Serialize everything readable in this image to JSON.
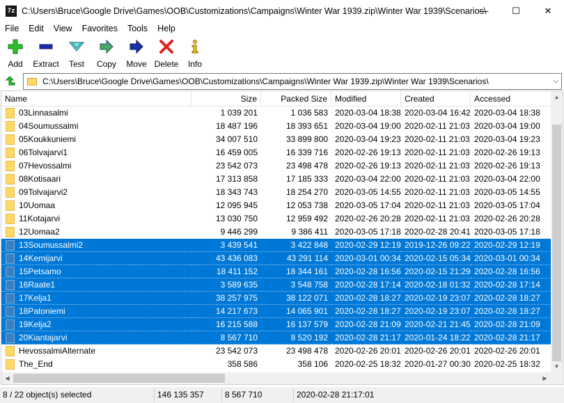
{
  "window": {
    "app_icon_text": "7z",
    "title": "C:\\Users\\Bruce\\Google Drive\\Games\\OOB\\Customizations\\Campaigns\\Winter War 1939.zip\\Winter War 1939\\Scenarios\\",
    "minimize": "—",
    "maximize": "☐",
    "close": "✕"
  },
  "menu": [
    "File",
    "Edit",
    "View",
    "Favorites",
    "Tools",
    "Help"
  ],
  "toolbar": [
    {
      "label": "Add",
      "icon": "add-icon"
    },
    {
      "label": "Extract",
      "icon": "extract-icon"
    },
    {
      "label": "Test",
      "icon": "test-icon"
    },
    {
      "label": "Copy",
      "icon": "copy-icon"
    },
    {
      "label": "Move",
      "icon": "move-icon"
    },
    {
      "label": "Delete",
      "icon": "delete-icon"
    },
    {
      "label": "Info",
      "icon": "info-icon"
    }
  ],
  "address": {
    "path": "C:\\Users\\Bruce\\Google Drive\\Games\\OOB\\Customizations\\Campaigns\\Winter War 1939.zip\\Winter War 1939\\Scenarios\\"
  },
  "columns": [
    "Name",
    "Size",
    "Packed Size",
    "Modified",
    "Created",
    "Accessed"
  ],
  "rows": [
    {
      "name": "03Linnasalmi",
      "size": "1 039 201",
      "packed": "1 036 583",
      "modified": "2020-03-04 18:38",
      "created": "2020-03-04 16:42",
      "accessed": "2020-03-04 18:38",
      "selected": false
    },
    {
      "name": "04Soumussalmi",
      "size": "18 487 196",
      "packed": "18 393 651",
      "modified": "2020-03-04 19:00",
      "created": "2020-02-11 21:03",
      "accessed": "2020-03-04 19:00",
      "selected": false
    },
    {
      "name": "05Koukkuniemi",
      "size": "34 007 510",
      "packed": "33 899 800",
      "modified": "2020-03-04 19:23",
      "created": "2020-02-11 21:03",
      "accessed": "2020-03-04 19:23",
      "selected": false
    },
    {
      "name": "06Tolvajarvi1",
      "size": "16 459 005",
      "packed": "16 339 716",
      "modified": "2020-02-26 19:13",
      "created": "2020-02-11 21:03",
      "accessed": "2020-02-26 19:13",
      "selected": false
    },
    {
      "name": "07Hevossalmi",
      "size": "23 542 073",
      "packed": "23 498 478",
      "modified": "2020-02-26 19:13",
      "created": "2020-02-11 21:03",
      "accessed": "2020-02-26 19:13",
      "selected": false
    },
    {
      "name": "08Kotisaari",
      "size": "17 313 858",
      "packed": "17 185 333",
      "modified": "2020-03-04 22:00",
      "created": "2020-02-11 21:03",
      "accessed": "2020-03-04 22:00",
      "selected": false
    },
    {
      "name": "09Tolvajarvi2",
      "size": "18 343 743",
      "packed": "18 254 270",
      "modified": "2020-03-05 14:55",
      "created": "2020-02-11 21:03",
      "accessed": "2020-03-05 14:55",
      "selected": false
    },
    {
      "name": "10Uomaa",
      "size": "12 095 945",
      "packed": "12 053 738",
      "modified": "2020-03-05 17:04",
      "created": "2020-02-11 21:03",
      "accessed": "2020-03-05 17:04",
      "selected": false
    },
    {
      "name": "11Kotajarvi",
      "size": "13 030 750",
      "packed": "12 959 492",
      "modified": "2020-02-26 20:28",
      "created": "2020-02-11 21:03",
      "accessed": "2020-02-26 20:28",
      "selected": false
    },
    {
      "name": "12Uomaa2",
      "size": "9 446 299",
      "packed": "9 386 411",
      "modified": "2020-03-05 17:18",
      "created": "2020-02-28 20:41",
      "accessed": "2020-03-05 17:18",
      "selected": false
    },
    {
      "name": "13Soumussalmi2",
      "size": "3 439 541",
      "packed": "3 422 848",
      "modified": "2020-02-29 12:19",
      "created": "2019-12-26 09:22",
      "accessed": "2020-02-29 12:19",
      "selected": true
    },
    {
      "name": "14Kemijarvi",
      "size": "43 436 083",
      "packed": "43 291 114",
      "modified": "2020-03-01 00:34",
      "created": "2020-02-15 05:34",
      "accessed": "2020-03-01 00:34",
      "selected": true
    },
    {
      "name": "15Petsamo",
      "size": "18 411 152",
      "packed": "18 344 161",
      "modified": "2020-02-28 16:56",
      "created": "2020-02-15 21:29",
      "accessed": "2020-02-28 16:56",
      "selected": true
    },
    {
      "name": "16Raate1",
      "size": "3 589 635",
      "packed": "3 548 758",
      "modified": "2020-02-28 17:14",
      "created": "2020-02-18 01:32",
      "accessed": "2020-02-28 17:14",
      "selected": true
    },
    {
      "name": "17Kelja1",
      "size": "38 257 975",
      "packed": "38 122 071",
      "modified": "2020-02-28 18:27",
      "created": "2020-02-19 23:07",
      "accessed": "2020-02-28 18:27",
      "selected": true
    },
    {
      "name": "18Patoniemi",
      "size": "14 217 673",
      "packed": "14 065 901",
      "modified": "2020-02-28 18:27",
      "created": "2020-02-19 23:07",
      "accessed": "2020-02-28 18:27",
      "selected": true
    },
    {
      "name": "19Kelja2",
      "size": "16 215 588",
      "packed": "16 137 579",
      "modified": "2020-02-28 21:09",
      "created": "2020-02-21 21:45",
      "accessed": "2020-02-28 21:09",
      "selected": true
    },
    {
      "name": "20Kiantajarvi",
      "size": "8 567 710",
      "packed": "8 520 192",
      "modified": "2020-02-28 21:17",
      "created": "2020-01-24 18:22",
      "accessed": "2020-02-28 21:17",
      "selected": true
    },
    {
      "name": "HevossalmiAlternate",
      "size": "23 542 073",
      "packed": "23 498 478",
      "modified": "2020-02-26 20:01",
      "created": "2020-02-26 20:01",
      "accessed": "2020-02-26 20:01",
      "selected": false
    },
    {
      "name": "The_End",
      "size": "358 586",
      "packed": "358 106",
      "modified": "2020-02-25 18:32",
      "created": "2020-01-27 00:30",
      "accessed": "2020-02-25 18:32",
      "selected": false
    }
  ],
  "status": {
    "selected": "8 / 22 object(s) selected",
    "total_size": "146 135 357",
    "item_size": "8 567 710",
    "item_date": "2020-02-28 21:17:01"
  },
  "colors": {
    "selection": "#0078d7",
    "folder": "#ffd966"
  }
}
